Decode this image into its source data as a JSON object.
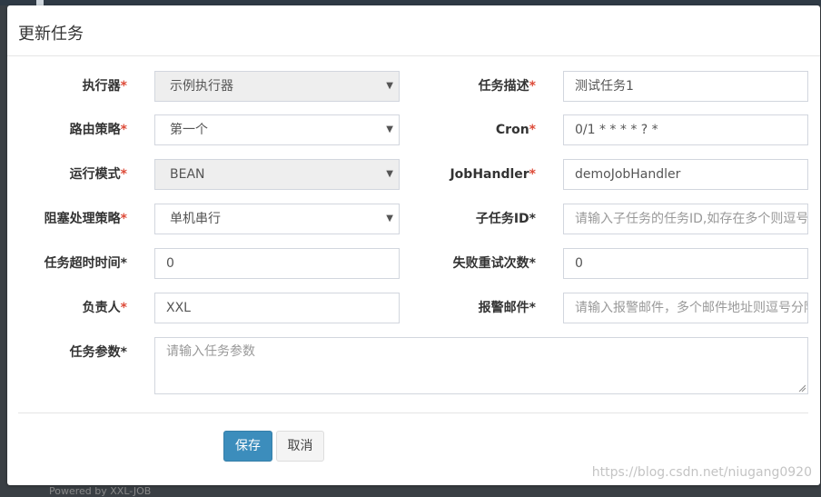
{
  "modal": {
    "title": "更新任务"
  },
  "left_fields": [
    {
      "label": "执行器",
      "required": "*",
      "value": "示例执行器",
      "type": "select",
      "disabled": true
    },
    {
      "label": "路由策略",
      "required": "*",
      "value": "第一个",
      "type": "select",
      "disabled": false
    },
    {
      "label": "运行模式",
      "required": "*",
      "value": "BEAN",
      "type": "select",
      "disabled": true
    },
    {
      "label": "阻塞处理策略",
      "required": "*",
      "value": "单机串行",
      "type": "select",
      "disabled": false
    },
    {
      "label": "任务超时时间",
      "required": "*",
      "value": "0",
      "type": "input"
    },
    {
      "label": "负责人",
      "required": "*",
      "value": "XXL",
      "type": "input"
    }
  ],
  "right_fields": [
    {
      "label": "任务描述",
      "required": "*",
      "value": "测试任务1",
      "placeholder": ""
    },
    {
      "label": "Cron",
      "required": "*",
      "value": "0/1 * * * * ? *",
      "placeholder": ""
    },
    {
      "label": "JobHandler",
      "required": "*",
      "value": "demoJobHandler",
      "placeholder": ""
    },
    {
      "label": "子任务ID*",
      "required": "",
      "value": "",
      "placeholder": "请输入子任务的任务ID,如存在多个则逗号分隔"
    },
    {
      "label": "失败重试次数*",
      "required": "",
      "value": "0",
      "placeholder": ""
    },
    {
      "label": "报警邮件*",
      "required": "",
      "value": "",
      "placeholder": "请输入报警邮件，多个邮件地址则逗号分隔"
    }
  ],
  "params": {
    "label": "任务参数*",
    "placeholder": "请输入任务参数"
  },
  "buttons": {
    "save": "保存",
    "cancel": "取消"
  },
  "footer": {
    "text": "Powered by XXL-JOB",
    "watermark": "https://blog.csdn.net/niugang0920"
  },
  "colors": {
    "primary": "#3c8dbc",
    "required": "#dd4b39"
  }
}
